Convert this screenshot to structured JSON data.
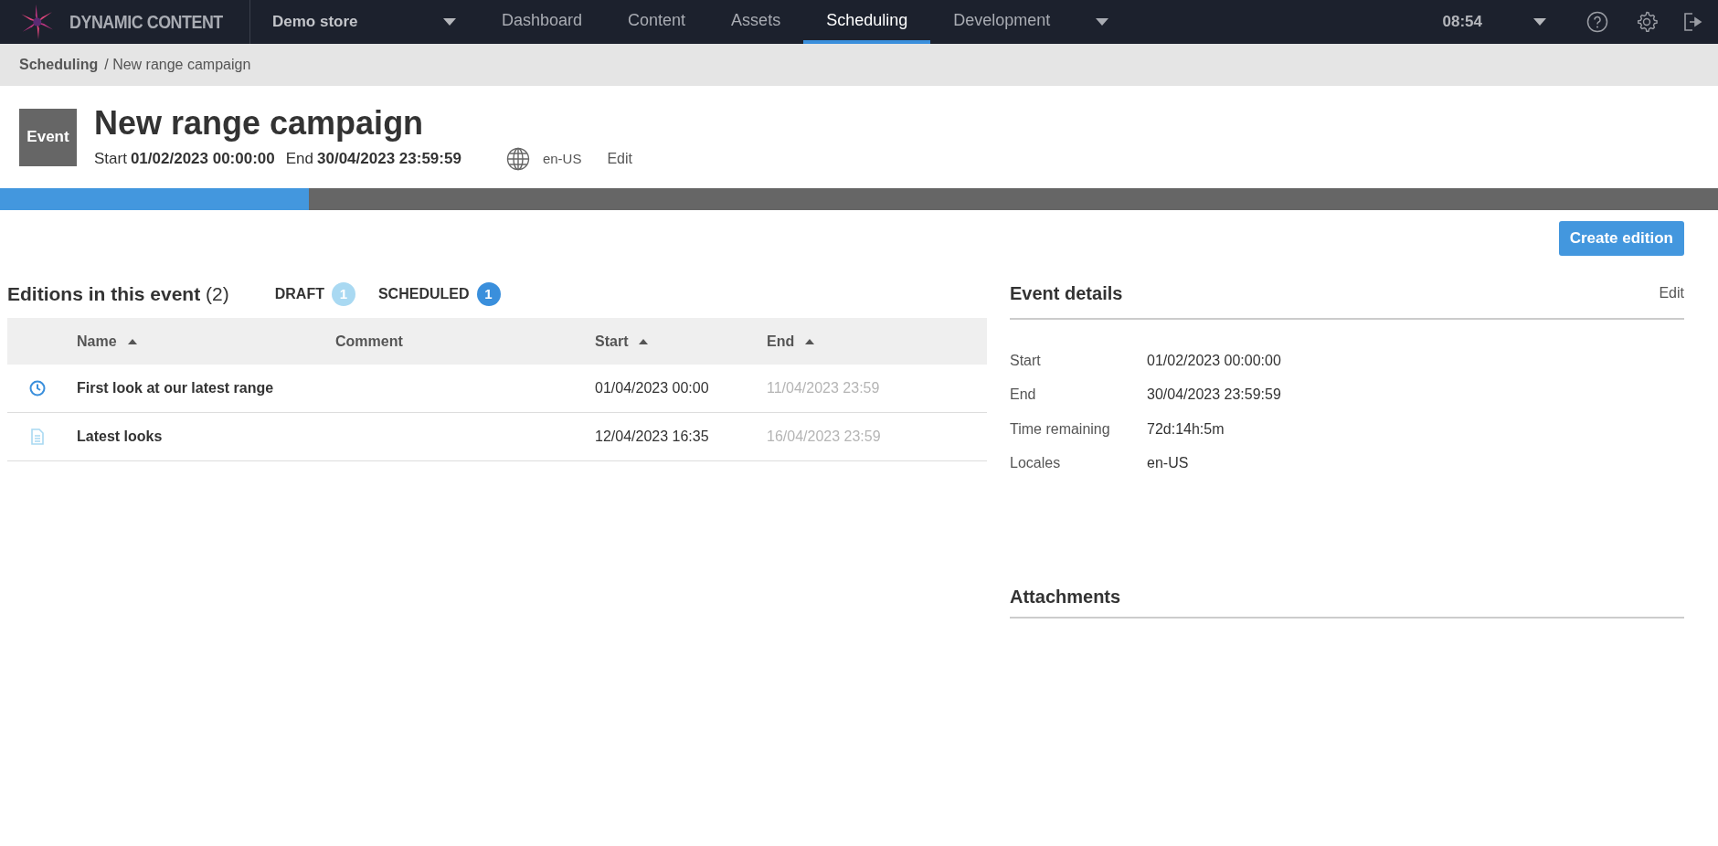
{
  "app": {
    "brand": "DYNAMIC CONTENT",
    "store": "Demo store",
    "time": "08:54"
  },
  "nav": [
    {
      "label": "Dashboard",
      "selected": false
    },
    {
      "label": "Content",
      "selected": false
    },
    {
      "label": "Assets",
      "selected": false
    },
    {
      "label": "Scheduling",
      "selected": true
    },
    {
      "label": "Development",
      "selected": false
    }
  ],
  "breadcrumb": {
    "parent": "Scheduling",
    "current": "/ New range campaign"
  },
  "event": {
    "badge": "Event",
    "title": "New range campaign",
    "start_label": "Start",
    "start": "01/02/2023 00:00:00",
    "end_label": "End",
    "end": "30/04/2023 23:59:59",
    "locale": "en-US",
    "edit": "Edit",
    "level": 0.18
  },
  "create_button": "Create edition",
  "editions": {
    "title": "Editions in this event",
    "count": "(2)",
    "statuses": [
      {
        "label": "DRAFT",
        "count": "1",
        "color": "#a9d9f2"
      },
      {
        "label": "SCHEDULED",
        "count": "1",
        "color": "#3a8fdc"
      }
    ],
    "columns": [
      {
        "label": "Name",
        "sorted": true
      },
      {
        "label": "Comment",
        "sorted": false
      },
      {
        "label": "Start",
        "sorted": true
      },
      {
        "label": "End",
        "sorted": true
      }
    ],
    "rows": [
      {
        "kind": "scheduled",
        "name": "First look at our latest range",
        "start": "01/04/2023 00:00",
        "end": "11/04/2023 23:59"
      },
      {
        "kind": "draft",
        "name": "Latest looks",
        "start": "12/04/2023 16:35",
        "end": "16/04/2023 23:59"
      }
    ]
  },
  "details": {
    "title": "Event details",
    "edit": "Edit",
    "fields": [
      {
        "label": "Start",
        "value": "01/02/2023 00:00:00"
      },
      {
        "label": "End",
        "value": "30/04/2023 23:59:59"
      },
      {
        "label": "Time remaining",
        "value": "72d:14h:5m"
      },
      {
        "label": "Locales",
        "value": "en-US"
      }
    ]
  },
  "attachments": {
    "title": "Attachments"
  }
}
